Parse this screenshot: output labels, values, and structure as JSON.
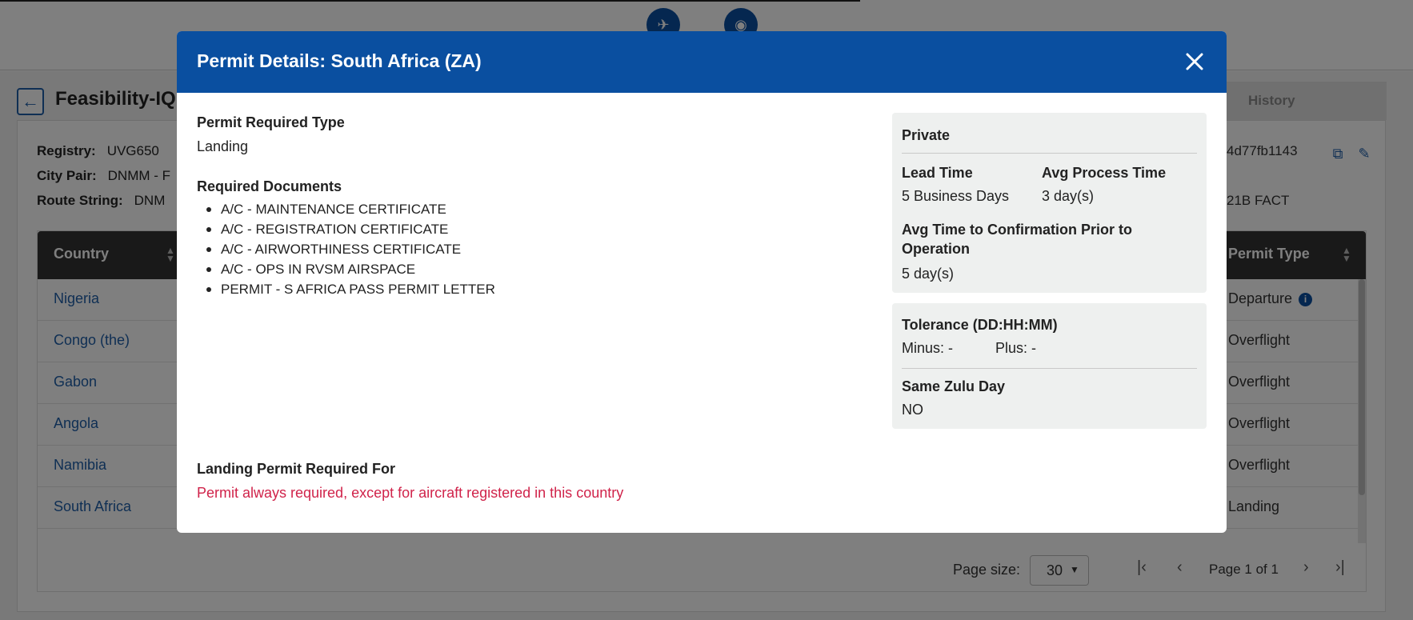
{
  "background": {
    "title": "Feasibility-IQ F",
    "tab_history": "History",
    "registry": {
      "label": "Registry:",
      "value": "UVG650"
    },
    "city_pair": {
      "label": "City Pair:",
      "value": "DNMM - F"
    },
    "route_string": {
      "label": "Route String:",
      "value": "DNM"
    },
    "trip_id_fragment": "4d77fb1143",
    "route_fragment": "21B FACT",
    "grid": {
      "col_country": "Country",
      "col_permit_type": "Permit Type",
      "rows": [
        {
          "country": "Nigeria",
          "type": "Departure"
        },
        {
          "country": "Congo (the)",
          "type": "Overflight"
        },
        {
          "country": "Gabon",
          "type": "Overflight"
        },
        {
          "country": "Angola",
          "type": "Overflight"
        },
        {
          "country": "Namibia",
          "type": "Overflight"
        },
        {
          "country": "South Africa",
          "type": "Landing"
        }
      ]
    },
    "pager": {
      "page_size_label": "Page size:",
      "page_size_value": "30",
      "page_text": "Page 1 of 1"
    },
    "icons": {
      "top_left": "airport-icon",
      "top_right": "globe-search-icon",
      "copy": "copy-icon",
      "feedback": "feedback-icon",
      "back": "arrow-left-icon",
      "info": "info-icon"
    }
  },
  "modal": {
    "title": "Permit Details: South Africa (ZA)",
    "close_icon": "close-icon",
    "permit_required_type_label": "Permit Required Type",
    "permit_required_type_value": "Landing",
    "required_documents_label": "Required Documents",
    "documents": [
      "A/C - MAINTENANCE CERTIFICATE",
      "A/C - REGISTRATION CERTIFICATE",
      "A/C - AIRWORTHINESS CERTIFICATE",
      "A/C - OPS IN RVSM AIRSPACE",
      "PERMIT - S AFRICA PASS PERMIT LETTER"
    ],
    "side_panel": {
      "category": "Private",
      "lead_time_label": "Lead Time",
      "lead_time_value": "5 Business Days",
      "avg_process_label": "Avg Process Time",
      "avg_process_value": "3 day(s)",
      "avg_confirm_label_line1": "Avg Time to Confirmation Prior to",
      "avg_confirm_label_line2": "Operation",
      "avg_confirm_value": "5 day(s)"
    },
    "tolerance": {
      "label": "Tolerance (DD:HH:MM)",
      "minus": "Minus: -",
      "plus": "Plus: -",
      "same_zulu_label": "Same Zulu Day",
      "same_zulu_value": "NO"
    },
    "landing_required_label": "Landing Permit Required For",
    "landing_required_note": "Permit always required, except for aircraft registered in this country"
  }
}
